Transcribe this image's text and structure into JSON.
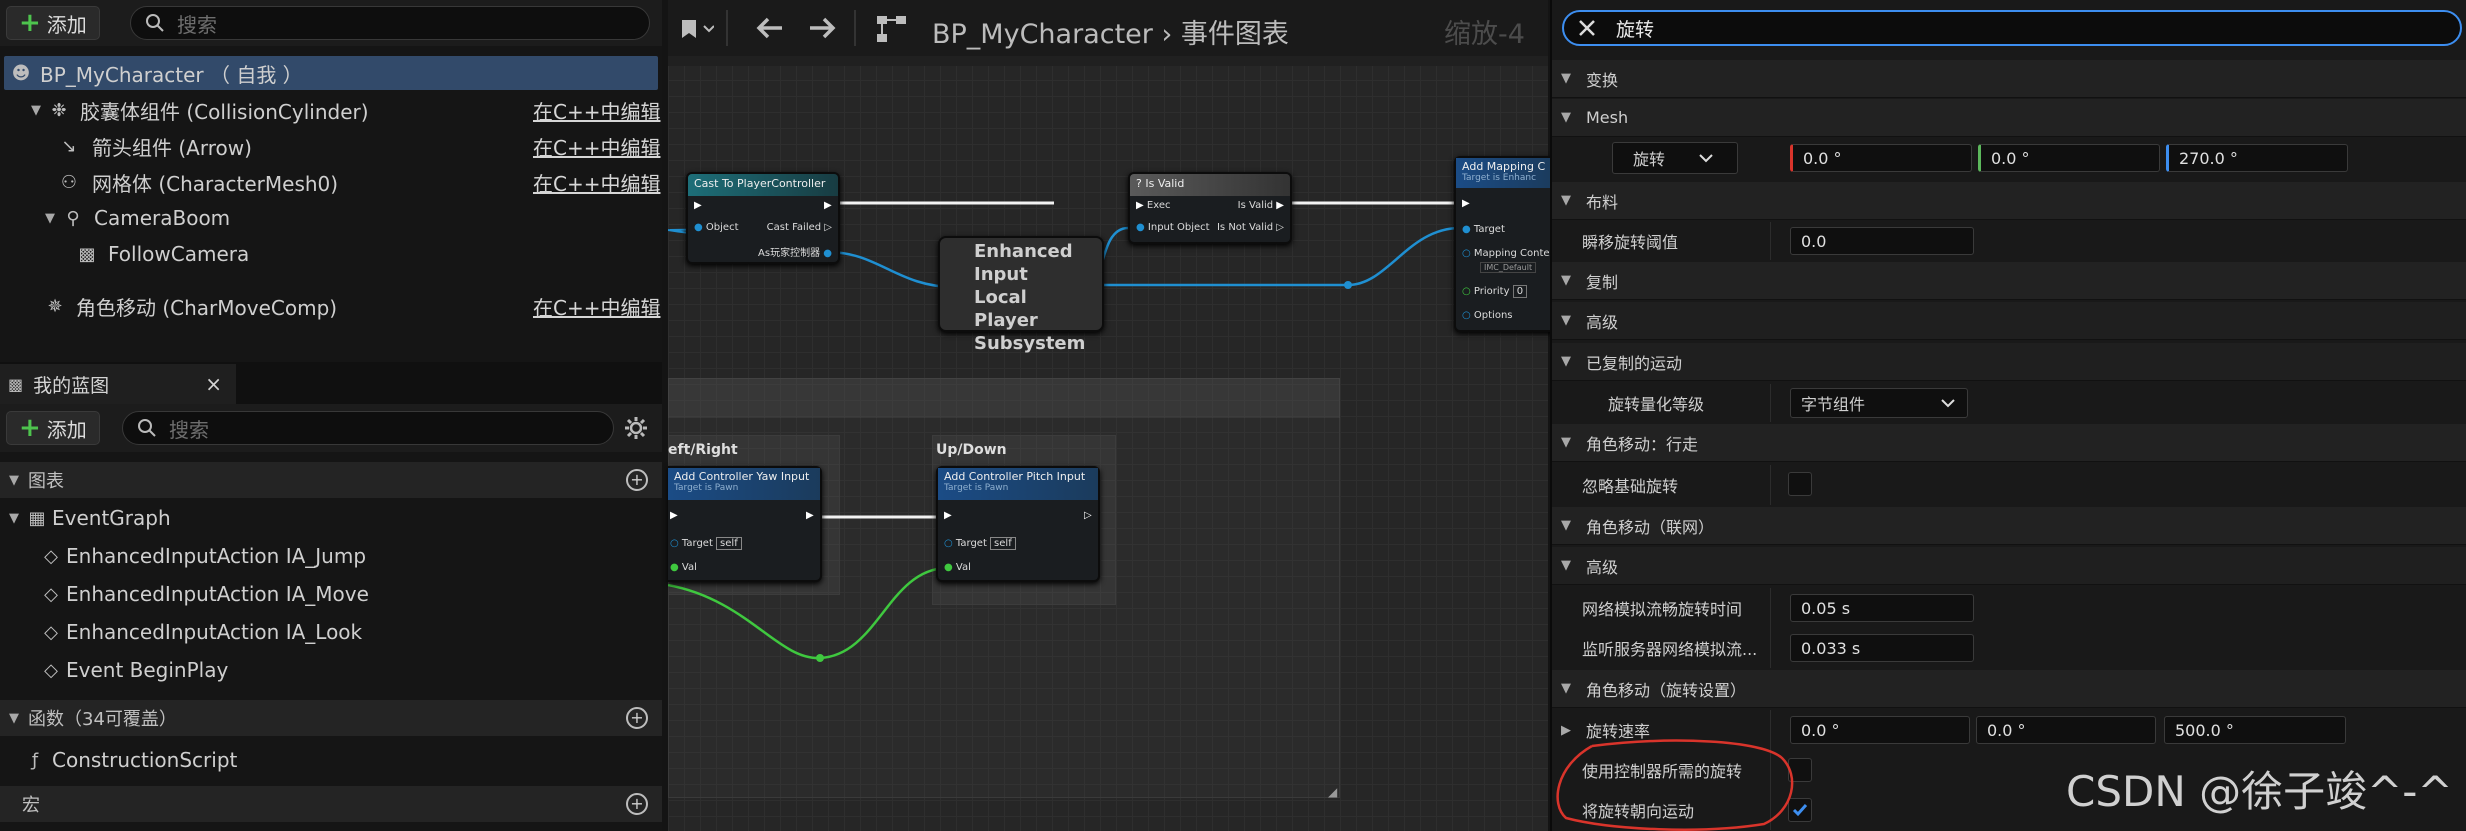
{
  "components": {
    "add_label": "添加",
    "search_placeholder": "搜索",
    "root_item": "BP_MyCharacter （ 自我 ）",
    "items": [
      {
        "label": "胶囊体组件 (CollisionCylinder)",
        "edit": "在C++中编辑"
      },
      {
        "label": "箭头组件 (Arrow)",
        "edit": "在C++中编辑"
      },
      {
        "label": "网格体 (CharacterMesh0)",
        "edit": "在C++中编辑"
      },
      {
        "label": "CameraBoom"
      },
      {
        "label": "FollowCamera"
      },
      {
        "label": "角色移动 (CharMoveComp)",
        "edit": "在C++中编辑"
      }
    ]
  },
  "my_blueprint": {
    "tab_label": "我的蓝图",
    "close_glyph": "×",
    "add_label": "添加",
    "search_placeholder": "搜索",
    "graphs_section": "图表",
    "event_graph": "EventGraph",
    "events": [
      "EnhancedInputAction IA_Jump",
      "EnhancedInputAction IA_Move",
      "EnhancedInputAction IA_Look",
      "Event BeginPlay"
    ],
    "functions_section": "函数（34可覆盖）",
    "construction_script": "ConstructionScript",
    "macros_section": "宏"
  },
  "graph_toolbar": {
    "blueprint_name": "BP_MyCharacter",
    "separator": "›",
    "graph_name": "事件图表",
    "zoom": "缩放-4"
  },
  "nodes": {
    "cast": {
      "title": "Cast To PlayerController",
      "object": "Object",
      "cast_failed": "Cast Failed",
      "as_pc": "As玩家控制器"
    },
    "is_valid": {
      "title": "Is Valid",
      "exec": "Exec",
      "is_valid": "Is Valid",
      "input_object": "Input Object",
      "is_not_valid": "Is Not Valid"
    },
    "subsystem": {
      "title": "Enhanced Input Local Player Subsystem"
    },
    "add_mapping": {
      "title": "Add Mapping C",
      "subtitle": "Target is Enhanc",
      "target": "Target",
      "mapping": "Mapping Contex",
      "mapping_value": "IMC_Default",
      "priority": "Priority",
      "priority_value": "0",
      "options": "Options"
    },
    "left_right_group": "eft/Right",
    "up_down_group": "Up/Down",
    "yaw": {
      "title": "Add Controller Yaw Input",
      "subtitle": "Target is Pawn",
      "target": "Target",
      "self": "self",
      "val": "Val"
    },
    "pitch": {
      "title": "Add Controller Pitch Input",
      "subtitle": "Target is Pawn",
      "target": "Target",
      "self": "self",
      "val": "Val"
    }
  },
  "details": {
    "search_value": "旋转",
    "cat_transform": "变换",
    "cat_mesh": "Mesh",
    "mesh_rot_label": "旋转",
    "mesh_rot": [
      "0.0 °",
      "0.0 °",
      "270.0 °"
    ],
    "cat_cloth": "布料",
    "teleport_label": "瞬移旋转阈值",
    "teleport_value": "0.0",
    "cat_replication": "复制",
    "cat_advanced": "高级",
    "cat_replicated_movement": "已复制的运动",
    "rot_quant_label": "旋转量化等级",
    "rot_quant_value": "字节组件",
    "cat_walking": "角色移动：行走",
    "ignore_base_label": "忽略基础旋转",
    "cat_networking": "角色移动（联网）",
    "cat_advanced2": "高级",
    "net_smooth_label": "网络模拟流畅旋转时间",
    "net_smooth_value": "0.05 s",
    "listen_label": "监听服务器网络模拟流...",
    "listen_value": "0.033 s",
    "cat_rotation_settings": "角色移动（旋转设置）",
    "rot_rate_label": "旋转速率",
    "rot_rate": [
      "0.0 °",
      "0.0 °",
      "500.0 °"
    ],
    "use_controller_label": "使用控制器所需的旋转",
    "use_controller_checked": false,
    "orient_label": "将旋转朝向运动",
    "orient_checked": true
  },
  "watermark": "CSDN @徐子竣^-^",
  "colors": {
    "accent_blue": "#3d8ef0",
    "highlight_red": "#d9342b",
    "selected_row": "#324a6a"
  }
}
